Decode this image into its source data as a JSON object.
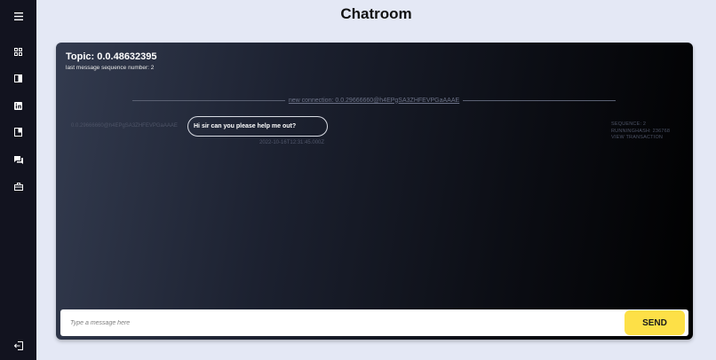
{
  "page": {
    "title": "Chatroom"
  },
  "sidebar": {
    "items": [
      {
        "icon": "menu-icon"
      },
      {
        "icon": "dashboard-grid-icon"
      },
      {
        "icon": "panel-icon"
      },
      {
        "icon": "linkedin-icon"
      },
      {
        "icon": "book-icon"
      },
      {
        "icon": "chat-icon"
      },
      {
        "icon": "briefcase-icon"
      },
      {
        "icon": "logout-icon"
      }
    ]
  },
  "chat": {
    "topic": "Topic: 0.0.48632395",
    "sequence_line": "last message sequence number: 2",
    "connection_text": "new connection: 0.0.29666660@h4EPgSA3ZHFEVPGaAAAE",
    "message": {
      "sender": "0.0.29666660@h4EPgSA3ZHFEVPGaAAAE",
      "text": "Hi sir can you please help me out?",
      "timestamp": "2022-10-16T12:31:45.000Z",
      "sequence": "SEQUENCE: 2",
      "running_hash": "RUNNINGHASH: 236768",
      "view_transaction": "VIEW TRANSACTION"
    }
  },
  "composer": {
    "placeholder": "Type a message here",
    "value": "",
    "send_label": "SEND"
  },
  "colors": {
    "page_background": "#e4e8f5",
    "sidebar": "#12131f",
    "send_button": "#fde047"
  }
}
